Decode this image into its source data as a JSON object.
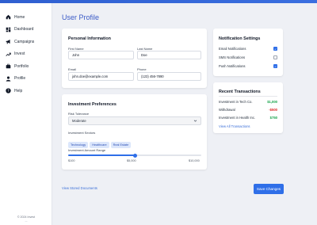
{
  "sidebar": {
    "items": [
      {
        "label": "Home",
        "icon": "home-icon"
      },
      {
        "label": "Dashboard",
        "icon": "dashboard-icon"
      },
      {
        "label": "Campaigns",
        "icon": "campaigns-icon"
      },
      {
        "label": "Invest",
        "icon": "trend-up-icon"
      },
      {
        "label": "Portfolio",
        "icon": "briefcase-icon"
      },
      {
        "label": "Profile",
        "icon": "user-icon"
      },
      {
        "label": "Help",
        "icon": "help-icon"
      }
    ],
    "footer_line1": "© 2024 Invest",
    "footer_line2": "..."
  },
  "page": {
    "title": "User Profile"
  },
  "personal": {
    "title": "Personal Information",
    "first_name_label": "First Name",
    "first_name_value": "John",
    "last_name_label": "Last Name",
    "last_name_value": "Doe",
    "email_label": "Email",
    "email_value": "john.doe@example.com",
    "phone_label": "Phone",
    "phone_value": "(123) 456-7890"
  },
  "investment": {
    "title": "Investment Preferences",
    "risk_label": "Risk Tolerance",
    "risk_value": "Moderate",
    "sectors_label": "Investment Sectors",
    "sectors": [
      "Technology",
      "Healthcare",
      "Real Estate"
    ],
    "range_label": "Investment Amount Range",
    "range_min": "$100",
    "range_mid": "$5,000",
    "range_max": "$10,000",
    "range_fraction": 0.5
  },
  "notifications": {
    "title": "Notification Settings",
    "items": [
      {
        "label": "Email Notifications",
        "checked": true
      },
      {
        "label": "SMS Notifications",
        "checked": false
      },
      {
        "label": "Push Notifications",
        "checked": true
      }
    ]
  },
  "transactions": {
    "title": "Recent Transactions",
    "items": [
      {
        "label": "Investment in Tech Co.",
        "amount": "$1,000",
        "color": "#16a34a"
      },
      {
        "label": "Withdrawal",
        "amount": "-$500",
        "color": "#dc2626"
      },
      {
        "label": "Investment in Health Inc.",
        "amount": "$750",
        "color": "#16a34a"
      }
    ],
    "view_all": "View All Transactions"
  },
  "footer_actions": {
    "stored_docs": "View Stored Documents",
    "save": "Save Changes"
  },
  "colors": {
    "accent": "#2f6fe8",
    "title": "#3b5bc7"
  }
}
